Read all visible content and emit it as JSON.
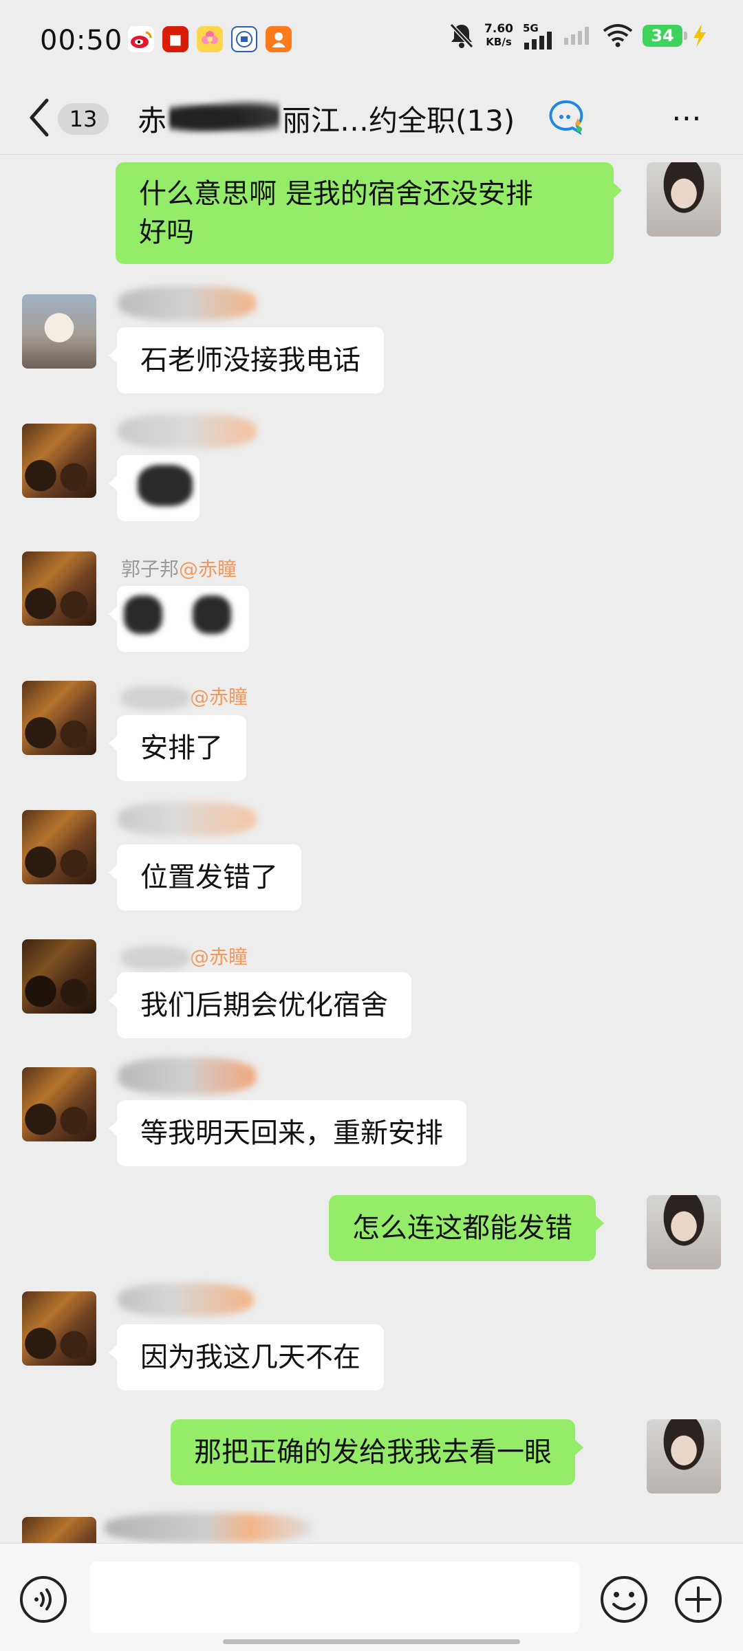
{
  "status_bar": {
    "time": "00:50",
    "net_speed_value": "7.60",
    "net_speed_unit": "KB/s",
    "network_type": "5G",
    "battery": "34"
  },
  "header": {
    "unread_count": "13",
    "title_prefix": "赤",
    "title_suffix": "丽江…约全职(13)"
  },
  "messages": {
    "m1": {
      "text_line1": "什么意思啊 是我的宿舍还没安排",
      "text_line2": "好吗"
    },
    "m2": {
      "text": "石老师没接我电话"
    },
    "m4": {
      "sender_name": "郭子邦",
      "mention": "@赤瞳"
    },
    "m5": {
      "text": "安排了",
      "mention": "@赤瞳"
    },
    "m6": {
      "text": "位置发错了"
    },
    "m7": {
      "text": "我们后期会优化宿舍",
      "mention": "@赤瞳"
    },
    "m8": {
      "text": "等我明天回来，重新安排"
    },
    "m9": {
      "text": "怎么连这都能发错"
    },
    "m10": {
      "text": "因为我这几天不在"
    },
    "m11": {
      "text": "那把正确的发给我我去看一眼"
    }
  },
  "input": {
    "value": "",
    "placeholder": ""
  },
  "colors": {
    "outgoing_bubble": "#95ec69",
    "incoming_bubble": "#ffffff",
    "background": "#ededed",
    "mention": "#f19a5c"
  },
  "icons": [
    "weibo-icon",
    "news-icon",
    "flower-icon",
    "campus-icon",
    "app-icon",
    "mute-icon",
    "signal-icon",
    "wifi-icon",
    "battery-icon",
    "back-icon",
    "ai-search-icon",
    "more-icon",
    "voice-icon",
    "emoji-icon",
    "plus-icon"
  ]
}
